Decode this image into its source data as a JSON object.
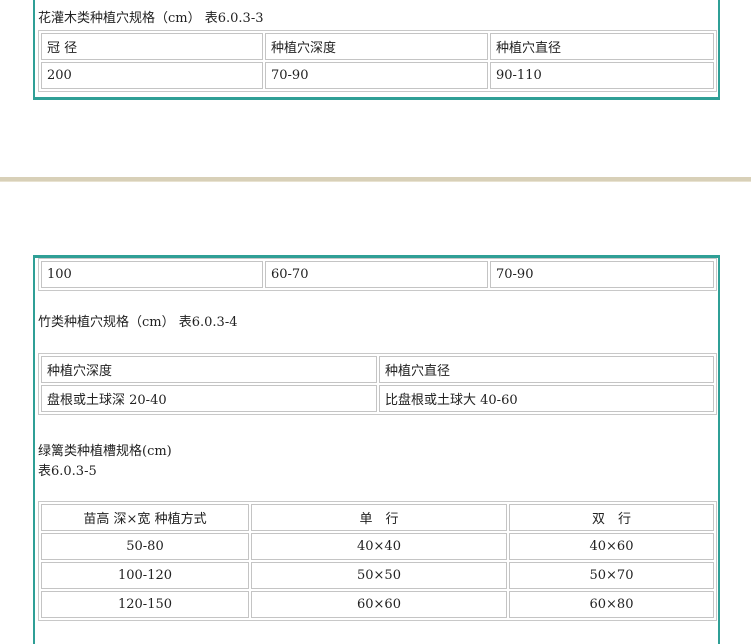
{
  "shrub": {
    "caption": "花灌木类种植穴规格（cm） 表6.0.3-3",
    "rows": [
      [
        "冠 径",
        "种植穴深度",
        "种植穴直径"
      ],
      [
        "200",
        "70-90",
        "90-110"
      ]
    ]
  },
  "shrub_cont": {
    "rows": [
      [
        "100",
        "60-70",
        "70-90"
      ]
    ]
  },
  "bamboo": {
    "caption": "竹类种植穴规格（cm） 表6.0.3-4",
    "rows": [
      [
        "种植穴深度",
        "种植穴直径"
      ],
      [
        "盘根或土球深 20-40",
        "比盘根或土球大 40-60"
      ]
    ]
  },
  "hedge": {
    "caption_line1": "绿篱类种植槽规格(cm)",
    "caption_line2": "表6.0.3-5",
    "rows": [
      [
        "苗高 深×宽 种植方式",
        "单　行",
        "双　行"
      ],
      [
        "50-80",
        "40×40",
        "40×60"
      ],
      [
        "100-120",
        "50×50",
        "50×70"
      ],
      [
        "120-150",
        "60×60",
        "60×80"
      ]
    ]
  },
  "colors": {
    "frame": "#2f9f96",
    "divider": "#d8d0b8"
  }
}
